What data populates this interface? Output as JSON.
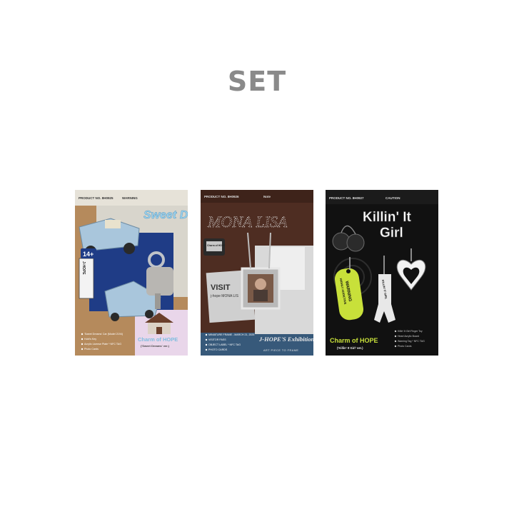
{
  "header": {
    "title": "SET"
  },
  "products": [
    {
      "product_no": "PRODUCT NO. 8H0925",
      "warning": "WARNING",
      "title": "Sweet Dreams",
      "age_badge": "14+",
      "plate": "J-HOPE",
      "charm_title": "Charm of HOPE",
      "charm_version": "('Sweet Dreams' ver.)",
      "contents": [
        "'Sweet Dreams' Car (Model 2194)",
        "Hobi's Key",
        "Acrylic License Plate * NFC TAG",
        "Photo Cards"
      ]
    },
    {
      "product_no": "PRODUCT NO. 8H0926",
      "note": "Note",
      "title": "MONA LISA",
      "badge_text": "Charm of HOPE",
      "visit_text": "VISIT",
      "visit_sub": "j-hope MONA LIS",
      "exhibition_title": "J-HOPE'S Exhibition",
      "exhibition_sub": "ART PIECE TO FRAME",
      "contents": [
        "MINIATURE FRAME - MARCH 21, 2025",
        "VISITOR PASS",
        "OBJECT LABEL * NFC TAG",
        "PHOTO CARDS"
      ]
    },
    {
      "product_no": "PRODUCT NO. 8H0927",
      "caution": "CAUTION",
      "title_line1": "Killin' It",
      "title_line2": "Girl",
      "tag_line1": "WARNING",
      "tag_line2": "HIGHLY ADDICTIVE",
      "hand_text": "KILLIN' IT GIRL",
      "charm_title": "Charm of HOPE",
      "charm_version": "('Killin' It Girl' ver.)",
      "contents": [
        "Killin' It Girl Finger Toy",
        "Heart Acrylic Board",
        "Warning Tag * NFC TAG",
        "Photo Cards"
      ]
    }
  ],
  "colors": {
    "page_bg": "#ffffff",
    "title_text": "#8a8a8a",
    "box1_brown": "#b58a5c",
    "box1_blue": "#a9c6dc",
    "box2_brown": "#4e2d22",
    "box2_blue": "#37597a",
    "box3_black": "#111111",
    "box3_lime": "#c8e03a"
  }
}
